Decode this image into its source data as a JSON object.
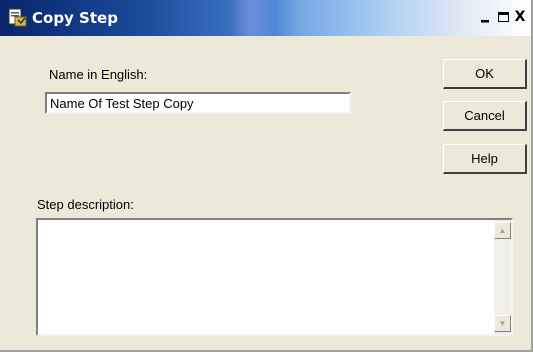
{
  "window": {
    "title": "Copy Step",
    "icon": "copy-step-app-icon",
    "controls": {
      "minimize_icon": "minimize-icon",
      "maximize_icon": "maximize-icon",
      "close_icon": "close-icon",
      "close_label": "X"
    }
  },
  "form": {
    "name_label": "Name in English:",
    "name_value": "Name Of Test Step Copy",
    "description_label": "Step description:",
    "description_value": ""
  },
  "buttons": {
    "ok_label": "OK",
    "cancel_label": "Cancel",
    "help_label": "Help"
  },
  "scrollbar": {
    "up_icon": "scroll-up-arrow-icon",
    "down_icon": "scroll-down-arrow-icon"
  },
  "colors": {
    "title_bar_start": "#0a246a",
    "title_bar_end": "#ffffff",
    "dialog_background": "#ece9d8"
  }
}
